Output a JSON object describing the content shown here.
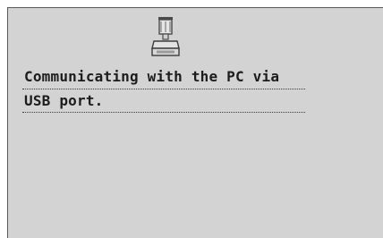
{
  "status_screen": {
    "icon": "usb-pc-connection-icon",
    "message_lines": [
      "Communicating with the PC via",
      "USB port."
    ]
  },
  "colors": {
    "background": "#d3d3d3",
    "text": "#1c1c1c"
  }
}
